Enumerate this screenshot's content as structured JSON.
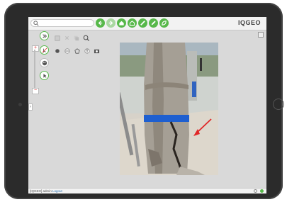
{
  "app": {
    "logo_text": "IQGEO",
    "accent_color": "#57b84a"
  },
  "search": {
    "placeholder": "",
    "icon": "search-icon"
  },
  "toolbar": {
    "nav_buttons": [
      {
        "name": "back-arrow-icon",
        "enabled": true
      },
      {
        "name": "forward-arrow-icon",
        "enabled": false
      },
      {
        "name": "home-icon",
        "enabled": true
      },
      {
        "name": "home-outline-icon",
        "enabled": true
      },
      {
        "name": "ruler-icon",
        "enabled": true
      },
      {
        "name": "pencil-icon",
        "enabled": true
      },
      {
        "name": "leaf-icon",
        "enabled": true
      }
    ]
  },
  "left_tools": {
    "zoom_plus": "+",
    "zoom_minus": "−"
  },
  "drawing_tools": [
    "point-icon",
    "line-icon",
    "polygon-icon",
    "text-icon",
    "camera-icon"
  ],
  "status_bar": {
    "text": "[IQGEO] admin",
    "link": "Logout"
  },
  "side_tab_label": "›"
}
